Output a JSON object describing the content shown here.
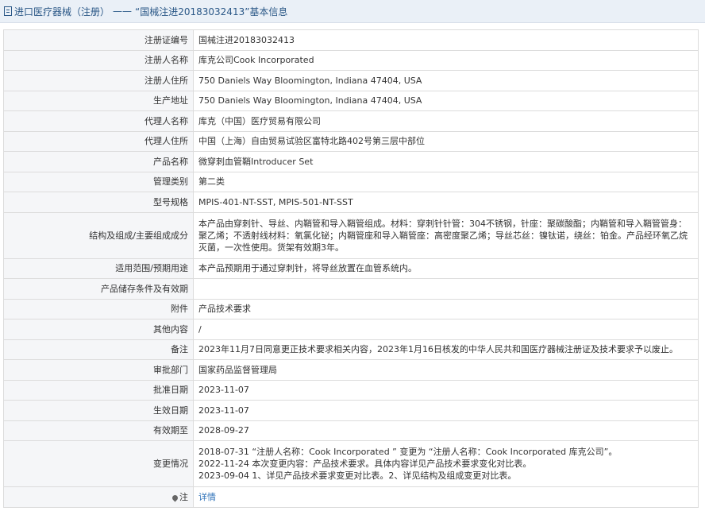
{
  "header": {
    "prefix": "进口医疗器械（注册）",
    "separator": "——",
    "title": "“国械注进20183032413”基本信息"
  },
  "rows": [
    {
      "label": "注册证编号",
      "value": "国械注进20183032413"
    },
    {
      "label": "注册人名称",
      "value": "库克公司Cook Incorporated"
    },
    {
      "label": "注册人住所",
      "value": "750 Daniels Way Bloomington, Indiana 47404, USA"
    },
    {
      "label": "生产地址",
      "value": "750 Daniels Way Bloomington, Indiana 47404, USA"
    },
    {
      "label": "代理人名称",
      "value": "库克（中国）医疗贸易有限公司"
    },
    {
      "label": "代理人住所",
      "value": "中国（上海）自由贸易试验区富特北路402号第三层中部位"
    },
    {
      "label": "产品名称",
      "value": "微穿刺血管鞘Introducer Set"
    },
    {
      "label": "管理类别",
      "value": "第二类"
    },
    {
      "label": "型号规格",
      "value": "MPIS-401-NT-SST, MPIS-501-NT-SST"
    },
    {
      "label": "结构及组成/主要组成成分",
      "value": "本产品由穿刺针、导丝、内鞘管和导入鞘管组成。材料：穿刺针针管：304不锈钢，针座：聚碳酸酯；内鞘管和导入鞘管管身：聚乙烯；不透射线材料：氧氯化铋；内鞘管座和导入鞘管座：高密度聚乙烯；导丝芯丝：镍钛诺，绕丝：铂金。产品经环氧乙烷灭菌，一次性使用。货架有效期3年。"
    },
    {
      "label": "适用范围/预期用途",
      "value": "本产品预期用于通过穿刺针，将导丝放置在血管系统内。"
    },
    {
      "label": "产品储存条件及有效期",
      "value": ""
    },
    {
      "label": "附件",
      "value": "产品技术要求"
    },
    {
      "label": "其他内容",
      "value": "/"
    },
    {
      "label": "备注",
      "value": "2023年11月7日同意更正技术要求相关内容，2023年1月16日核发的中华人民共和国医疗器械注册证及技术要求予以废止。"
    },
    {
      "label": "审批部门",
      "value": "国家药品监督管理局"
    },
    {
      "label": "批准日期",
      "value": "2023-11-07"
    },
    {
      "label": "生效日期",
      "value": "2023-11-07"
    },
    {
      "label": "有效期至",
      "value": "2028-09-27"
    }
  ],
  "change": {
    "label": "变更情况",
    "lines": [
      "2018-07-31 “注册人名称：Cook Incorporated ” 变更为 “注册人名称：Cook Incorporated 库克公司”。",
      "2022-11-24 本次变更内容：产品技术要求。具体内容详见产品技术要求变化对比表。",
      "2023-09-04 1、详见产品技术要求变更对比表。2、详见结构及组成变更对比表。"
    ]
  },
  "note": {
    "label": "注",
    "link": "详情"
  },
  "colors": {
    "header_bg": "#eaf0f7",
    "header_text": "#2b5887",
    "label_bg": "#f5f6f8",
    "border": "#dcdcdc",
    "link": "#2f72b8"
  }
}
